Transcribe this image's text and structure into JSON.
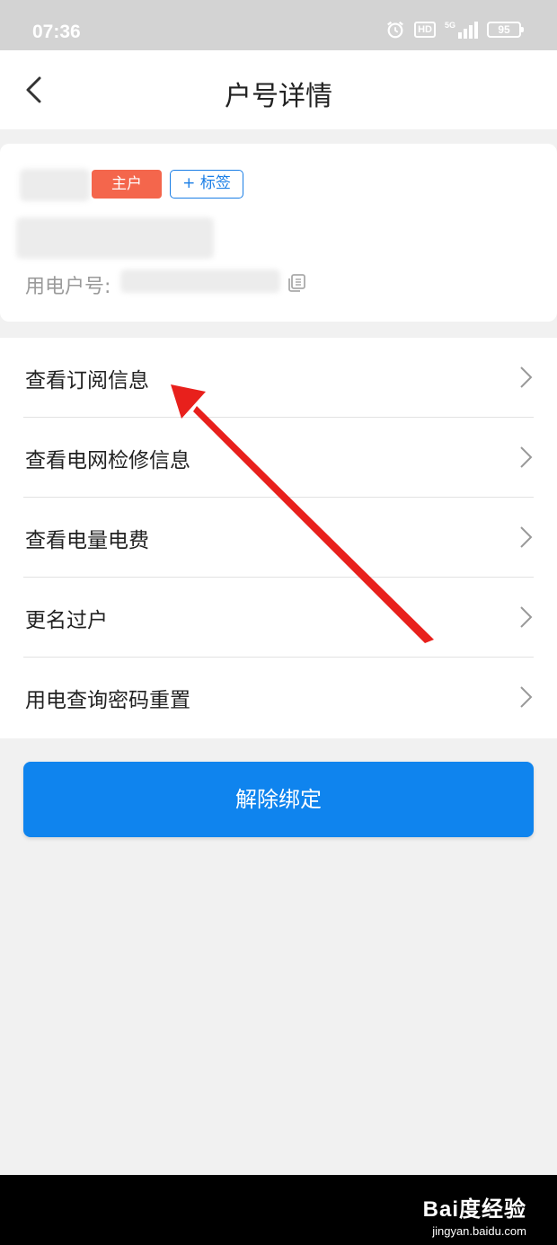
{
  "status_bar": {
    "time": "07:36",
    "hd_label": "HD",
    "network_label": "5G",
    "battery": "95"
  },
  "header": {
    "title": "户号详情"
  },
  "account": {
    "owner_badge": "主户",
    "tag_button": "+ 标签",
    "account_number_label": "用电户号:"
  },
  "menu": {
    "items": [
      {
        "label": "查看订阅信息"
      },
      {
        "label": "查看电网检修信息"
      },
      {
        "label": "查看电量电费"
      },
      {
        "label": "更名过户"
      },
      {
        "label": "用电查询密码重置"
      }
    ]
  },
  "actions": {
    "unbind_label": "解除绑定"
  },
  "watermark": {
    "brand": "Bai度经验",
    "url": "jingyan.baidu.com"
  },
  "colors": {
    "primary_blue": "#0f84ee",
    "owner_badge": "#f4664c",
    "annotation_arrow": "#e8201c"
  }
}
